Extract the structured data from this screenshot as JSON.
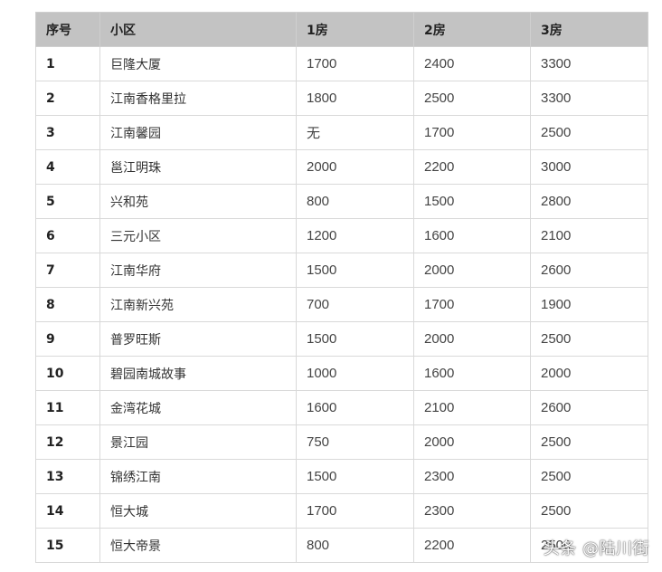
{
  "table": {
    "headers": [
      "序号",
      "小区",
      "1房",
      "2房",
      "3房"
    ],
    "rows": [
      [
        "1",
        "巨隆大厦",
        "1700",
        "2400",
        "3300"
      ],
      [
        "2",
        "江南香格里拉",
        "1800",
        "2500",
        "3300"
      ],
      [
        "3",
        "江南馨园",
        "无",
        "1700",
        "2500"
      ],
      [
        "4",
        "邕江明珠",
        "2000",
        "2200",
        "3000"
      ],
      [
        "5",
        "兴和苑",
        "800",
        "1500",
        "2800"
      ],
      [
        "6",
        "三元小区",
        "1200",
        "1600",
        "2100"
      ],
      [
        "7",
        "江南华府",
        "1500",
        "2000",
        "2600"
      ],
      [
        "8",
        "江南新兴苑",
        "700",
        "1700",
        "1900"
      ],
      [
        "9",
        "普罗旺斯",
        "1500",
        "2000",
        "2500"
      ],
      [
        "10",
        "碧园南城故事",
        "1000",
        "1600",
        "2000"
      ],
      [
        "11",
        "金湾花城",
        "1600",
        "2100",
        "2600"
      ],
      [
        "12",
        "景江园",
        "750",
        "2000",
        "2500"
      ],
      [
        "13",
        "锦绣江南",
        "1500",
        "2300",
        "2500"
      ],
      [
        "14",
        "恒大城",
        "1700",
        "2300",
        "2500"
      ],
      [
        "15",
        "恒大帝景",
        "800",
        "2200",
        "2500"
      ]
    ]
  },
  "watermark": "头条 @陆川街"
}
